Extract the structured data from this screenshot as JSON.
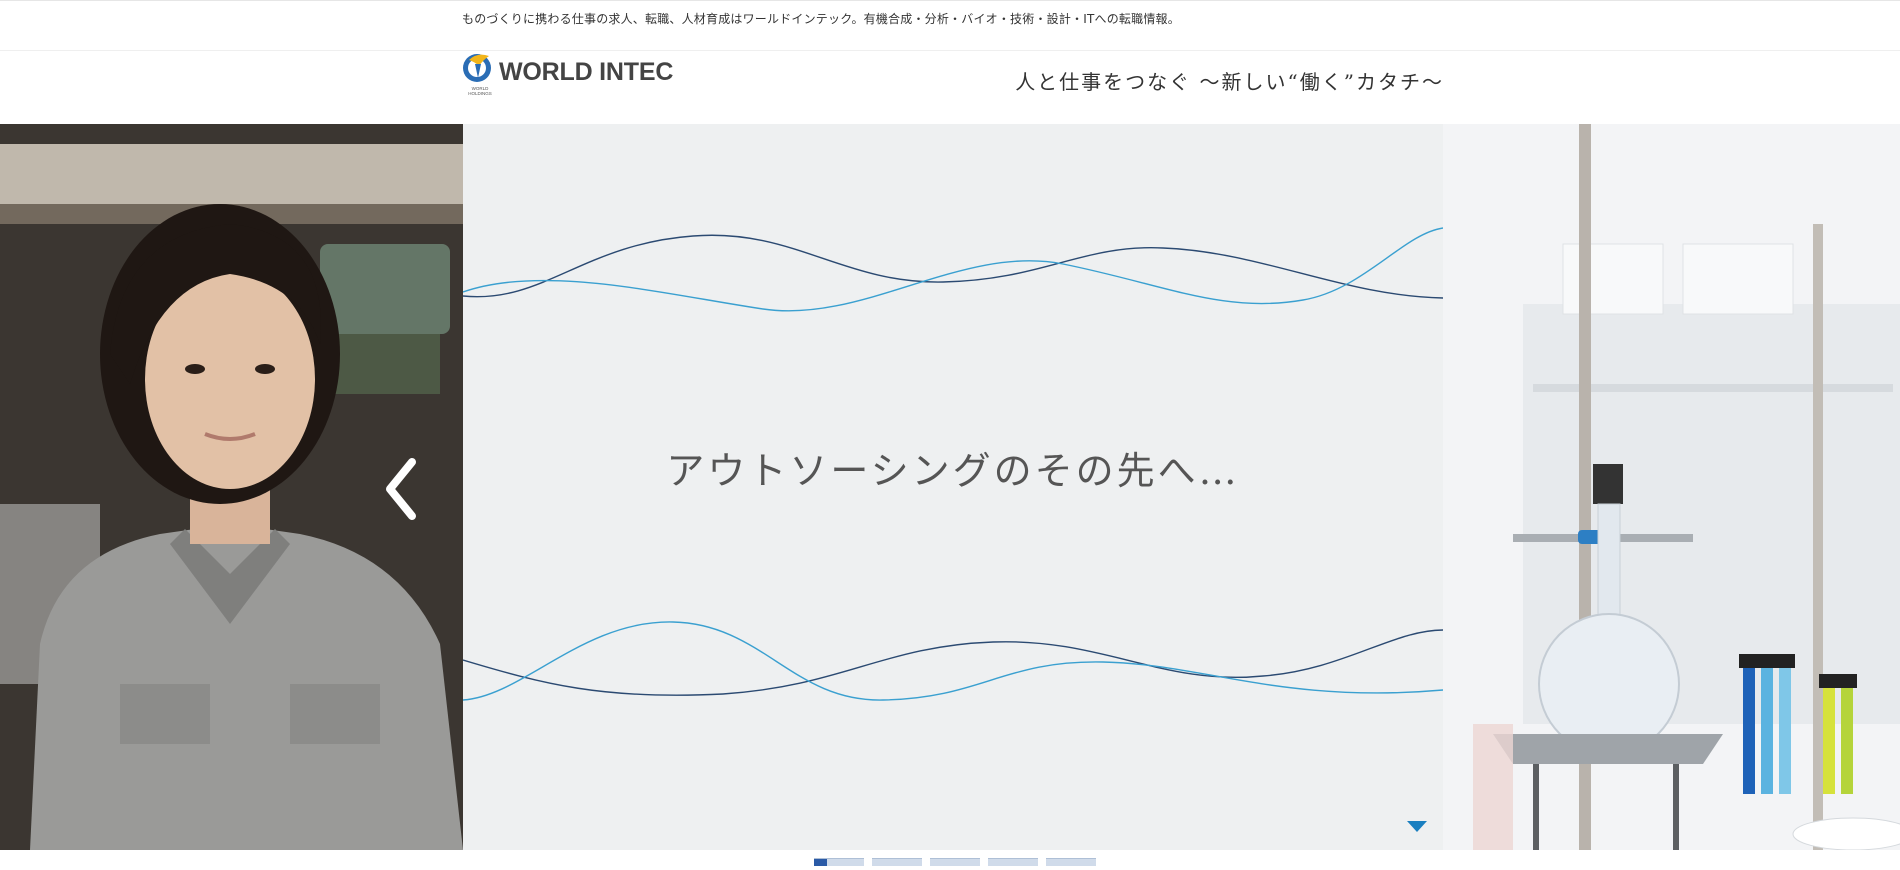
{
  "header": {
    "tagline": "ものづくりに携わる仕事の求人、転職、人材育成はワールドインテック。有機合成・分析・バイオ・技術・設計・ITへの転職情報。",
    "logo_text": "WORLD INTEC",
    "logo_subtext": "WORLD HOLDINGS",
    "catchphrase": "人と仕事をつなぐ ～新しい“働く”カタチ～"
  },
  "slider": {
    "headline": "アウトソーシングのその先へ…",
    "prev_icon": "chevron-left-icon",
    "scroll_icon": "triangle-down-icon",
    "left_image": "factory-worker-photo",
    "right_image": "laboratory-glassware-photo",
    "pager": {
      "count": 5,
      "active_index": 0
    }
  },
  "colors": {
    "brand_blue": "#2a5aa6",
    "wave_dark": "#2b4a72",
    "wave_light": "#3aa0d0",
    "pager_inactive": "#d0dbea"
  }
}
